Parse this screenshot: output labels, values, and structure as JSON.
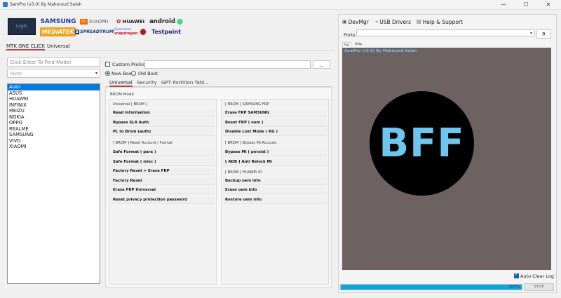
{
  "window": {
    "title": "SamPro (v3.0) By Mahmoud Salah",
    "minimize_glyph": "—",
    "maximize_glyph": "☐",
    "close_glyph": "✕"
  },
  "logos": {
    "login_text": "Login",
    "samsung": "SAMSUNG",
    "xiaomi": "XIAOMI",
    "huawei": "HUAWEI",
    "android": "android",
    "mediatek": "MEDIATEK",
    "spreadtrum": "SPREADTRUM",
    "qualcomm_top": "Qualcomm",
    "qualcomm_bottom": "snapdragon",
    "testpoint": "Testpoint"
  },
  "top_tabs": [
    "MTK ONE CLICK",
    "Universal"
  ],
  "model_search": {
    "placeholder": "Click Enter To Find Model"
  },
  "brand_select": {
    "value": "Auto"
  },
  "brand_list": [
    "Auto",
    "ASUS",
    "HUAWEI",
    "INFINIX",
    "MEIZU",
    "NOKIA",
    "OPPO",
    "REALME",
    "SAMSUNG",
    "VIVO",
    "XIAOMI"
  ],
  "preloader": {
    "label": "Custom Preloder",
    "browse_label": "..."
  },
  "boot_mode": {
    "new_boot": "New Boot",
    "old_boot": "Old Boot"
  },
  "sub_tabs": [
    "Universal",
    "Security",
    "GPT Partition Tabl..."
  ],
  "brom_mode_title": "BROM Mode",
  "left_sections": [
    {
      "header": "Universal [ BROM ]",
      "buttons": [
        "Read information",
        "Bypass SLA Auth",
        "PL to Brom (auth)"
      ]
    },
    {
      "header": "[ BROM ] Reset Account / Format",
      "buttons": [
        "Safe Format ( para )",
        "Safe Format ( misc )",
        "Factory Reset + Erase FRP",
        "Factory Reset",
        "Erase FRP Universal",
        "Reset privacy protection password"
      ]
    }
  ],
  "right_sections": [
    {
      "header": "[ BROM ] SAMSUNG FRP",
      "buttons": [
        "Erase FRP SAMSUNG",
        "Reset FRP ( oem )",
        "Disable Lost Mode ( KG )"
      ]
    },
    {
      "header": "[ BROM ] Bypass Mi Account",
      "buttons": [
        "Bypass Mi ( persist )",
        "[ ADB ] Anti Relock Mi"
      ]
    },
    {
      "header": "[ BROM ] HUAWEI ID",
      "buttons": [
        "Backup oem info",
        "Erase oem info",
        "Restore oem info"
      ]
    }
  ],
  "right_toolbar": {
    "devmgr": "DevMgr",
    "usb_drivers": "USB Drivers",
    "help_support": "Help & Support"
  },
  "ports": {
    "label": "Ports",
    "value": "",
    "refresh_label": "R"
  },
  "log_tabs": [
    "log",
    "Help"
  ],
  "log": {
    "title_line": "SamPro (v3.0) By Mahmoud Salah",
    "badge_text": "BFF",
    "auto_clear_label": "Auto Clear Log"
  },
  "progress": {
    "percent_text": "100%",
    "value": 1.0,
    "stop_label": "STOP"
  },
  "colors": {
    "accent": "#06a8e0",
    "log_background": "#6d6262",
    "badge_circle": "#000000",
    "badge_text": "#6ec6ee",
    "log_title": "#6ec6ee"
  }
}
